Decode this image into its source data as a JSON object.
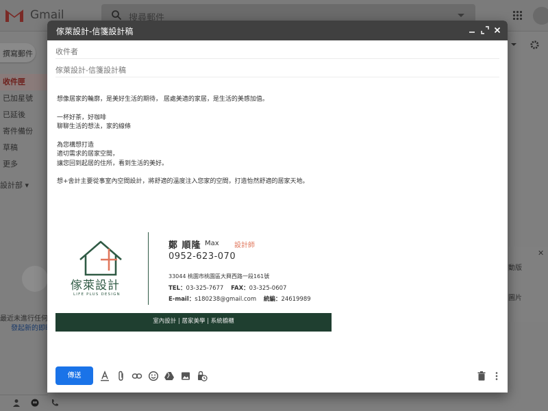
{
  "gmail": {
    "brand": "Gmail",
    "search_placeholder": "搜尋郵件",
    "compose_label": "撰寫郵件",
    "nav": [
      "收件匣",
      "已加星號",
      "已延後",
      "寄件備份",
      "草稿",
      "更多"
    ],
    "label_group": "設計部",
    "recent_text": "最近未進行任何",
    "recent_link": "發起新的即時",
    "right_panel": {
      "line1": "動版",
      "line2": "圖片"
    }
  },
  "compose": {
    "title": "傢萊設計-信箋設計稿",
    "to_placeholder": "收件者",
    "subject": "傢萊設計-信箋設計稿",
    "body": [
      [
        "想像居家的輪廓，是美好生活的期待， 居處美適的家居，是生活的美感加值。"
      ],
      [
        "一杯好茶，好咖啡",
        "聊聊生活的想法，家的線條"
      ],
      [
        "為您構想打造",
        "適切需求的居家空間，",
        "讓您回到起居的住所，看到生活的美好。"
      ],
      [
        "想+舍計主要從事室內空間設計，將舒適的溫度注入您家的空間，打造怡然舒適的居家天地。"
      ]
    ],
    "send_label": "傳送"
  },
  "signature": {
    "brand": "傢萊設計",
    "brand_en": "LIFE PLUS DESIGN",
    "name": "鄭 順隆",
    "name_en": "Max",
    "role": "設計師",
    "phone": "0952-623-070",
    "address": "33044 桃園市桃園區大興西路一段161號",
    "tel_label": "TEL：",
    "tel": "03-325-7677",
    "fax_label": "FAX：",
    "fax": "03-325-0607",
    "email_label": "E-mail：",
    "email": "s180238@gmail.com",
    "tax_label": "統編：",
    "tax": "24619989",
    "footer": "室內設計 | 居家美學 | 系統櫥櫃"
  },
  "colors": {
    "brand_green": "#2f5a44",
    "footer_bg": "#1f3f30",
    "role_orange": "#e0775c",
    "send_blue": "#1a73e8",
    "header_dark": "#404040"
  },
  "icons": [
    "gmail-logo-icon",
    "search-icon",
    "apps-icon",
    "gear-icon",
    "minimize-icon",
    "expand-icon",
    "close-icon",
    "format-text-icon",
    "attach-icon",
    "link-icon",
    "emoji-icon",
    "drive-icon",
    "photo-icon",
    "confidential-icon",
    "trash-icon",
    "more-vert-icon"
  ]
}
